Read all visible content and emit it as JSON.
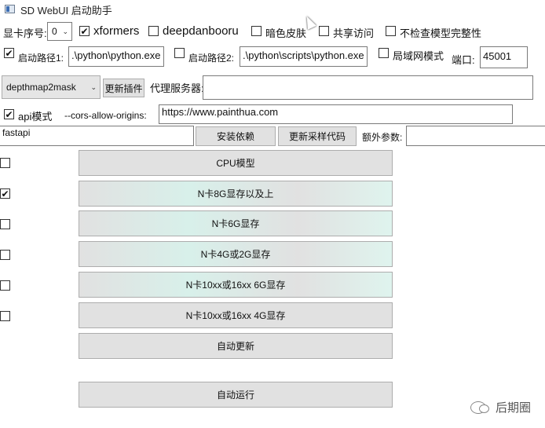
{
  "window": {
    "title": "SD WebUI 启动助手"
  },
  "row1": {
    "gpu_label": "显卡序号:",
    "gpu_value": "0",
    "xformers": {
      "label": "xformers",
      "checked": true
    },
    "deepdanbooru": {
      "label": "deepdanbooru",
      "checked": false
    },
    "dark_skin": {
      "label": "暗色皮肤",
      "checked": false
    },
    "share": {
      "label": "共享访问",
      "checked": false
    },
    "no_check": {
      "label": "不检查模型完整性",
      "checked": false
    }
  },
  "row2": {
    "path1": {
      "label": "启动路径1:",
      "checked": true,
      "value": ".\\python\\python.exe"
    },
    "path2": {
      "label": "启动路径2:",
      "checked": false,
      "value": ".\\python\\scripts\\python.exe"
    },
    "lan": {
      "label": "局域网模式",
      "checked": false
    },
    "port_label": "端口:",
    "port_value": "45001"
  },
  "row3": {
    "plugin_select": "depthmap2mask",
    "update_plugin": "更新插件",
    "proxy_label": "代理服务器:",
    "proxy_value": ""
  },
  "row4": {
    "api": {
      "label": "api模式",
      "checked": true
    },
    "cors_label": "--cors-allow-origins:",
    "cors_value": "https://www.painthua.com"
  },
  "row5": {
    "fastapi_value": "fastapi",
    "install_deps": "安装依赖",
    "update_sampler": "更新采样代码",
    "extra_label": "额外参数:",
    "extra_value": ""
  },
  "modes": [
    {
      "label": "CPU模型",
      "checked": false
    },
    {
      "label": "N卡8G显存以及上",
      "checked": true
    },
    {
      "label": "N卡6G显存",
      "checked": false
    },
    {
      "label": "N卡4G或2G显存",
      "checked": false
    },
    {
      "label": "N卡10xx或16xx 6G显存",
      "checked": false
    },
    {
      "label": "N卡10xx或16xx 4G显存",
      "checked": false
    }
  ],
  "auto_update": "自动更新",
  "auto_run": "自动运行",
  "watermark": "后期圈"
}
